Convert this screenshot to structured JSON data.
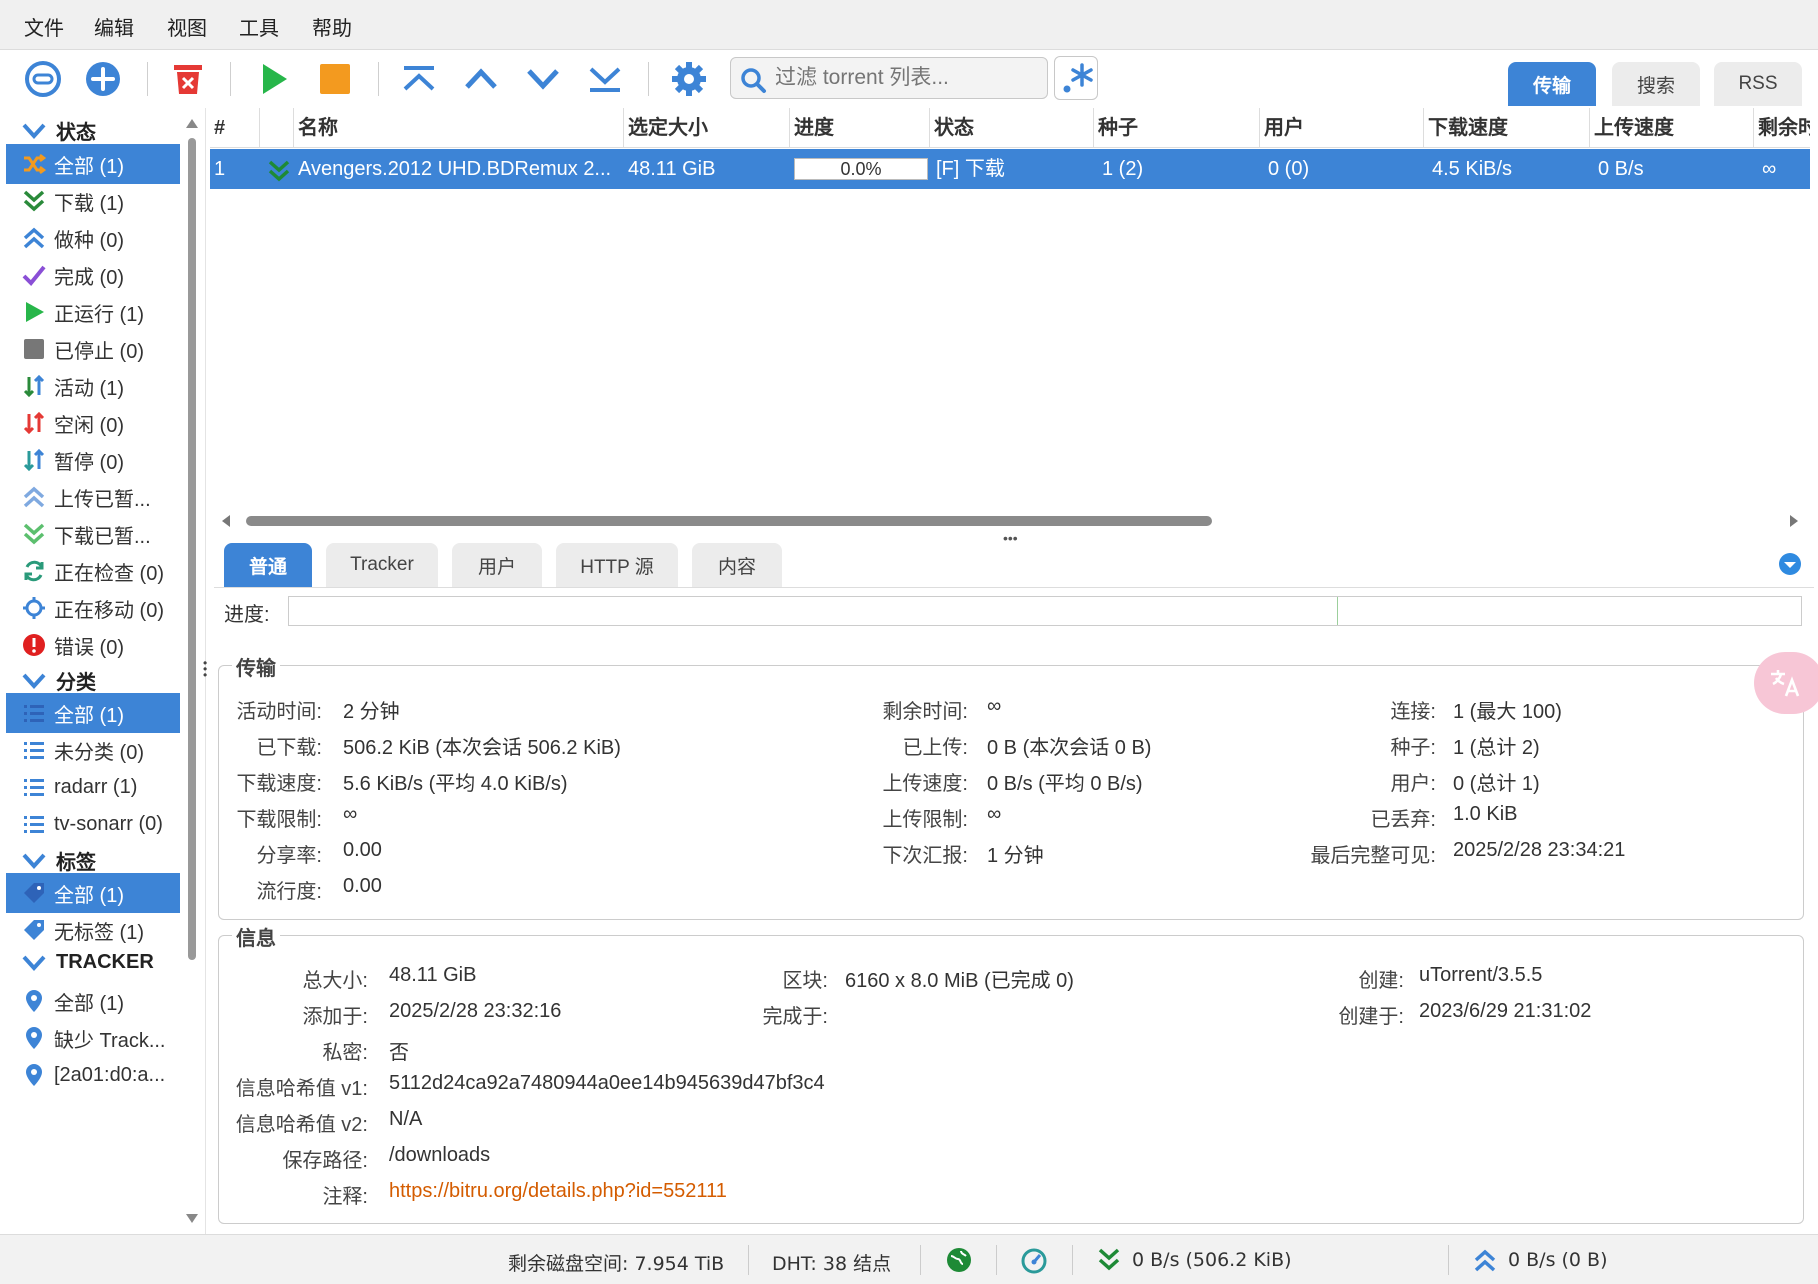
{
  "menu": [
    "文件",
    "编辑",
    "视图",
    "工具",
    "帮助"
  ],
  "toolbar": {
    "filter_placeholder": "过滤 torrent 列表...",
    "view_tabs": [
      "传输",
      "搜索",
      "RSS"
    ]
  },
  "sidebar": {
    "status_title": "状态",
    "status_items": [
      "全部 (1)",
      "下载 (1)",
      "做种 (0)",
      "完成 (0)",
      "正运行 (1)",
      "已停止 (0)",
      "活动 (1)",
      "空闲 (0)",
      "暂停 (0)",
      "上传已暂...",
      "下载已暂...",
      "正在检查 (0)",
      "正在移动 (0)",
      "错误 (0)"
    ],
    "category_title": "分类",
    "category_items": [
      "全部 (1)",
      "未分类 (0)",
      "radarr (1)",
      "tv-sonarr (0)"
    ],
    "tag_title": "标签",
    "tag_items": [
      "全部 (1)",
      "无标签 (1)"
    ],
    "tracker_title": "TRACKER",
    "tracker_items": [
      "全部 (1)",
      "缺少 Track...",
      "[2a01:d0:a..."
    ]
  },
  "table": {
    "columns": [
      "#",
      "名称",
      "选定大小",
      "进度",
      "状态",
      "种子",
      "用户",
      "下载速度",
      "上传速度",
      "剩余时"
    ],
    "row": {
      "num": "1",
      "name": "Avengers.2012 UHD.BDRemux 2...",
      "size": "48.11 GiB",
      "progress_text": "0.0%",
      "progress": 0.0,
      "status": "[F] 下载",
      "seeds": "1 (2)",
      "peers": "0 (0)",
      "down_speed": "4.5 KiB/s",
      "up_speed": "0 B/s",
      "eta": "∞"
    }
  },
  "panel": {
    "tabs": [
      "普通",
      "Tracker",
      "用户",
      "HTTP 源",
      "内容"
    ],
    "progress_label": "进度:",
    "transfer": {
      "title": "传输",
      "time_active_label": "活动时间:",
      "time_active": "2 分钟",
      "eta_label": "剩余时间:",
      "eta": "∞",
      "connections_label": "连接:",
      "connections": "1 (最大 100)",
      "downloaded_label": "已下载:",
      "downloaded": "506.2 KiB (本次会话 506.2 KiB)",
      "uploaded_label": "已上传:",
      "uploaded": "0 B (本次会话 0 B)",
      "seeds_label": "种子:",
      "seeds": "1 (总计 2)",
      "dl_speed_label": "下载速度:",
      "dl_speed": "5.6 KiB/s (平均 4.0 KiB/s)",
      "ul_speed_label": "上传速度:",
      "ul_speed": "0 B/s (平均 0 B/s)",
      "peers_label": "用户:",
      "peers": "0 (总计 1)",
      "dl_limit_label": "下载限制:",
      "dl_limit": "∞",
      "ul_limit_label": "上传限制:",
      "ul_limit": "∞",
      "wasted_label": "已丢弃:",
      "wasted": "1.0 KiB",
      "ratio_label": "分享率:",
      "ratio": "0.00",
      "reannounce_label": "下次汇报:",
      "reannounce": "1 分钟",
      "last_seen_label": "最后完整可见:",
      "last_seen": "2025/2/28 23:34:21",
      "popularity_label": "流行度:",
      "popularity": "0.00"
    },
    "info": {
      "title": "信息",
      "total_size_label": "总大小:",
      "total_size": "48.11 GiB",
      "pieces_label": "区块:",
      "pieces": "6160 x 8.0 MiB (已完成 0)",
      "created_by_label": "创建:",
      "created_by": "uTorrent/3.5.5",
      "added_on_label": "添加于:",
      "added_on": "2025/2/28 23:32:16",
      "completed_on_label": "完成于:",
      "completed_on": "",
      "created_on_label": "创建于:",
      "created_on": "2023/6/29 21:31:02",
      "private_label": "私密:",
      "private": "否",
      "hash_v1_label": "信息哈希值 v1:",
      "hash_v1": "5112d24ca92a7480944a0ee14b945639d47bf3c4",
      "hash_v2_label": "信息哈希值 v2:",
      "hash_v2": "N/A",
      "save_path_label": "保存路径:",
      "save_path": "/downloads",
      "comment_label": "注释:",
      "comment": "https://bitru.org/details.php?id=552111"
    }
  },
  "statusbar": {
    "free_space": "剩余磁盘空间: 7.954 TiB",
    "dht": "DHT: 38 结点",
    "download": "0 B/s (506.2 KiB)",
    "upload": "0 B/s (0 B)"
  },
  "colors": {
    "accent": "#3d84d6",
    "green": "#27b64a",
    "orange": "#f39a1f",
    "red": "#e53935"
  }
}
